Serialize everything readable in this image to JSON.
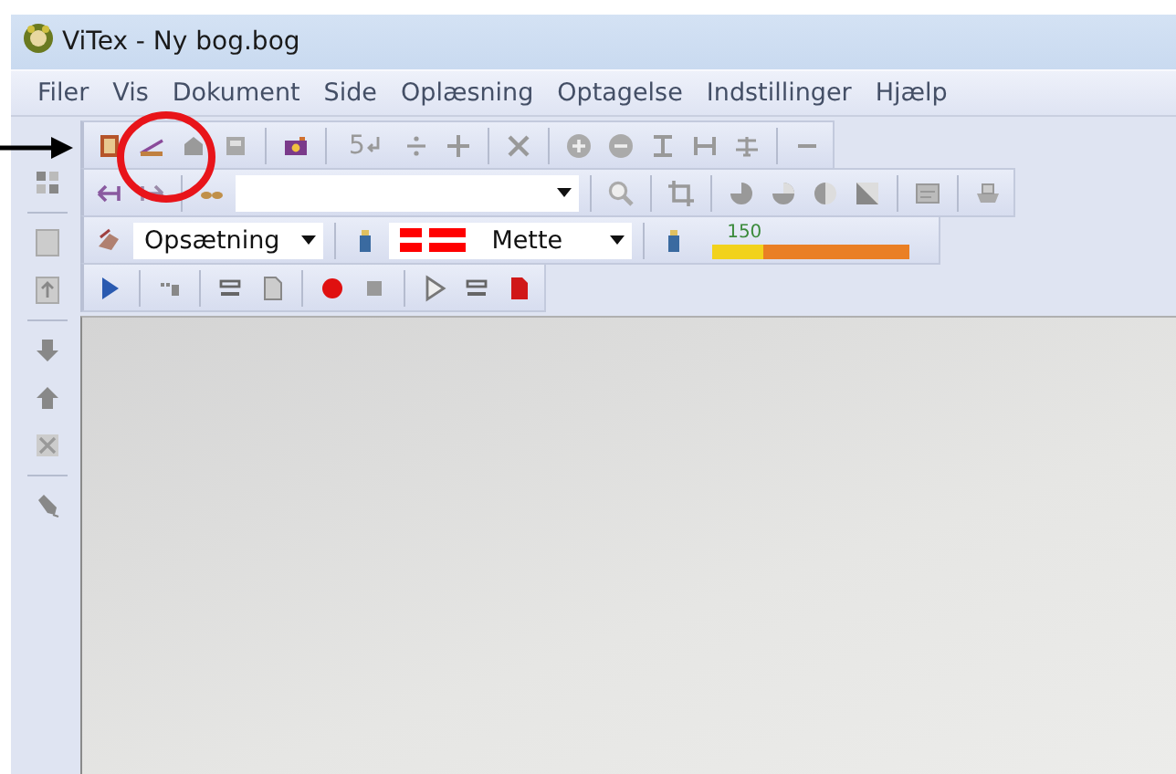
{
  "window": {
    "title": "ViTex - Ny bog.bog"
  },
  "menu": [
    {
      "label": "Filer"
    },
    {
      "label": "Vis"
    },
    {
      "label": "Dokument"
    },
    {
      "label": "Side"
    },
    {
      "label": "Oplæsning"
    },
    {
      "label": "Optagelse"
    },
    {
      "label": "Indstillinger"
    },
    {
      "label": "Hjælp"
    }
  ],
  "toolbar_1": {
    "page_number_button": "5"
  },
  "toolbar_3": {
    "setup_combo": "Opsætning",
    "voice_combo": "Mette",
    "speed_meter": {
      "reading": "150",
      "level": 0.26
    }
  }
}
